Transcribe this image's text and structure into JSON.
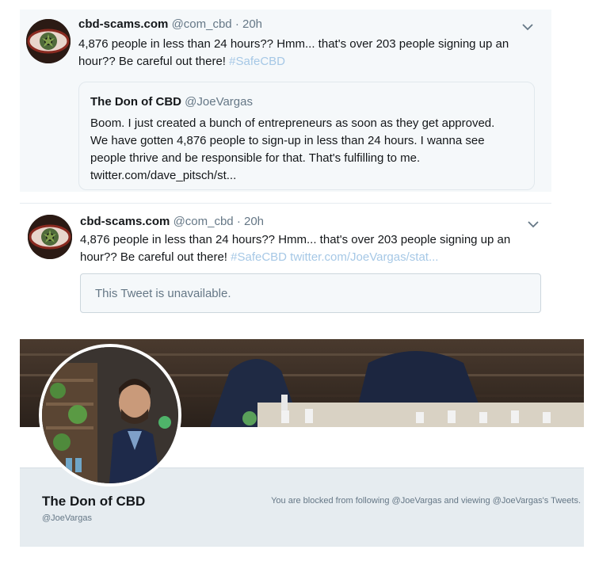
{
  "tweet1": {
    "name": "cbd-scams.com",
    "handle": "@com_cbd",
    "separator": "·",
    "time": "20h",
    "text": "4,876 people in less than 24 hours?? Hmm... that's over 203 people signing up an hour?? Be careful out there! ",
    "hashtag": "#SafeCBD",
    "avatar_icon": "eye-avatar-icon",
    "menu_icon": "chevron-down-icon",
    "quote": {
      "name": "The Don of CBD",
      "handle": "@JoeVargas",
      "text_lines": [
        "Boom. I just created a bunch of entrepreneurs as soon as they get approved.",
        "We have gotten 4,876 people to sign-up in less than 24 hours. I wanna see",
        "people thrive and be responsible for that. That's fulfilling to me.",
        "twitter.com/dave_pitsch/st..."
      ]
    }
  },
  "tweet2": {
    "name": "cbd-scams.com",
    "handle": "@com_cbd",
    "separator": "·",
    "time": "20h",
    "text": "4,876 people in less than 24 hours?? Hmm... that's over 203 people signing up an hour?? Be careful out there! ",
    "hashtag": "#SafeCBD",
    "link": "twitter.com/JoeVargas/stat...",
    "unavailable_text": "This Tweet is unavailable.",
    "avatar_icon": "eye-avatar-icon",
    "menu_icon": "chevron-down-icon"
  },
  "profile": {
    "name": "The Don of CBD",
    "handle": "@JoeVargas",
    "blocked_message": "You are blocked from following @JoeVargas and viewing @JoeVargas's Tweets."
  },
  "colors": {
    "hashtag": "#a6c8e6",
    "muted": "#657786",
    "tweet_background": "#f5f8fa",
    "profile_bar": "#e6ecf0"
  }
}
